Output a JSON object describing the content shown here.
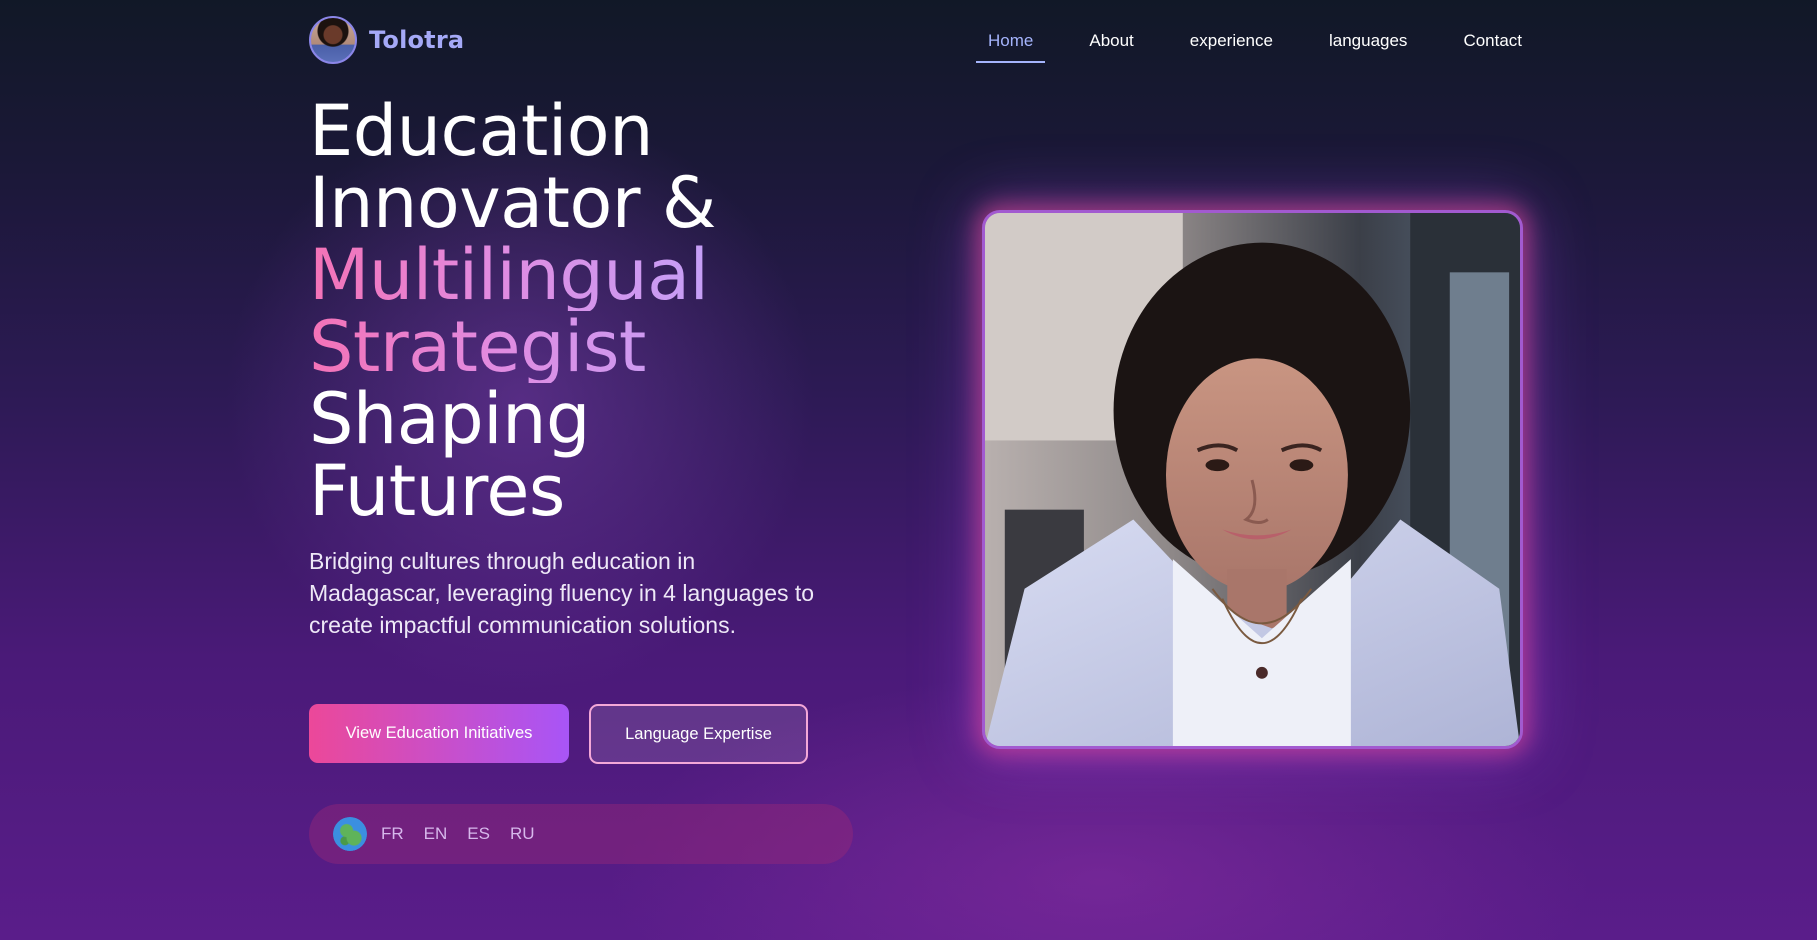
{
  "brand": {
    "name": "Tolotra",
    "avatar_icon": "profile-avatar"
  },
  "nav": {
    "items": [
      {
        "label": "Home",
        "active": true
      },
      {
        "label": "About",
        "active": false
      },
      {
        "label": "experience",
        "active": false
      },
      {
        "label": "languages",
        "active": false
      },
      {
        "label": "Contact",
        "active": false
      }
    ]
  },
  "hero": {
    "headline": {
      "line1": "Education",
      "line2": "Innovator &",
      "line3": "Multilingual",
      "line4": "Strategist",
      "line5": "Shaping",
      "line6": "Futures"
    },
    "subtitle": "Bridging cultures through education in Madagascar, leveraging fluency in 4 languages to create impactful communication solutions.",
    "primary_button": "View Education Initiatives",
    "secondary_button": "Language Expertise",
    "languages": {
      "icon": "globe-icon",
      "codes": [
        "FR",
        "EN",
        "ES",
        "RU"
      ]
    }
  },
  "colors": {
    "accent_pink": "#ec4899",
    "accent_purple": "#a855f7",
    "nav_active": "#a5b4fc"
  }
}
